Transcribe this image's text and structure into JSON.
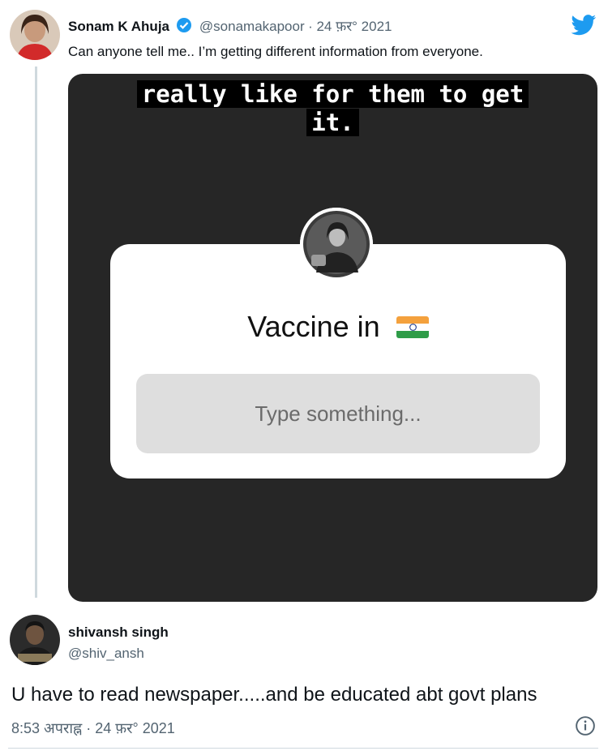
{
  "tweet": {
    "author_name": "Sonam K Ahuja",
    "handle": "@sonamakapoor",
    "date": "· 24 फ़र° 2021",
    "text": "Can anyone tell me.. I’m getting different information from everyone.",
    "story": {
      "caption_line1": "really like for them to get",
      "caption_line2": "it.",
      "question_title": "Vaccine in",
      "input_placeholder": "Type something..."
    }
  },
  "reply": {
    "author_name": "shivansh singh",
    "handle": "@shiv_ansh",
    "text": "U have to read newspaper.....and be educated abt govt plans",
    "timestamp": "8:53 अपराह्न · 24 फ़र° 2021"
  },
  "icons": {
    "brand": "twitter-bird-icon",
    "verified": "verified-badge-icon",
    "info": "info-icon",
    "flag": "india-flag-icon"
  },
  "colors": {
    "twitter_blue": "#1d9bf0",
    "story_bg": "#262626",
    "muted_text": "#536471"
  }
}
